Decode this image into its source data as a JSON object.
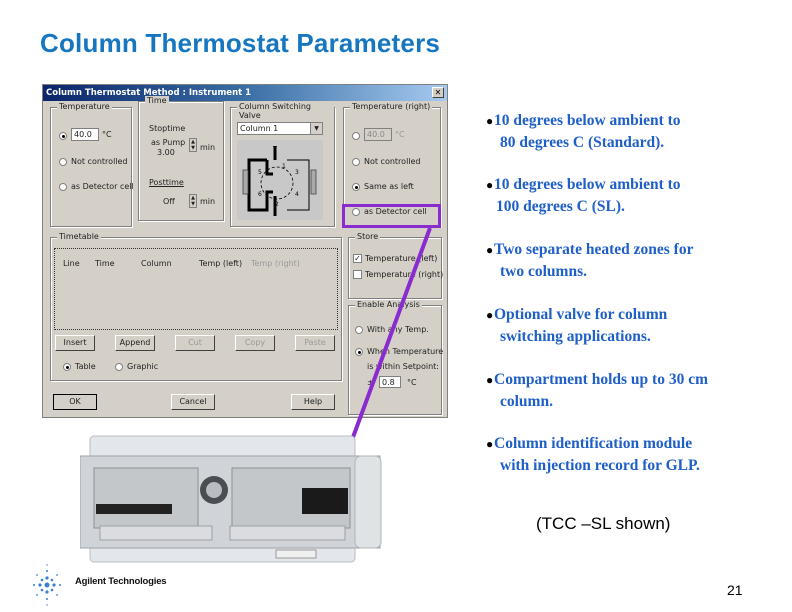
{
  "slide": {
    "title": "Column Thermostat Parameters",
    "page_number": "21",
    "caption": "(TCC –SL shown)",
    "logo_text": "Agilent Technologies",
    "accent_color": "#1677c0",
    "bullet_color": "#1f5fc8",
    "highlight_color": "#8a2bd0"
  },
  "dialog": {
    "title": "Column Thermostat Method : Instrument 1",
    "close_icon": "close-icon",
    "temperature": {
      "label": "Temperature",
      "value": "40.0",
      "unit": "°C",
      "options": [
        "Not controlled",
        "as Detector cell"
      ]
    },
    "time": {
      "label": "Time",
      "stoptime_label": "Stoptime",
      "stoptime_mode": "as Pump",
      "stoptime_value": "3.00",
      "stoptime_unit": "min",
      "posttime_label": "Posttime",
      "posttime_value": "Off",
      "posttime_unit": "min"
    },
    "valve": {
      "label": "Column Switching Valve",
      "selected": "Column 1",
      "ports": [
        "5",
        "6",
        "1",
        "2",
        "3",
        "4"
      ]
    },
    "temperature_right": {
      "label": "Temperature (right)",
      "value": "40.0",
      "unit": "°C",
      "options": [
        "Not controlled",
        "Same as left",
        "as Detector cell"
      ],
      "selected": "Same as left"
    },
    "timetable": {
      "label": "Timetable",
      "columns": [
        "Line",
        "Time",
        "Column",
        "Temp (left)",
        "Temp (right)"
      ],
      "rows": []
    },
    "buttons": {
      "insert": "Insert",
      "append": "Append",
      "cut": "Cut",
      "copy": "Copy",
      "paste": "Paste",
      "ok": "OK",
      "cancel": "Cancel",
      "help": "Help"
    },
    "view": {
      "table": "Table",
      "graphic": "Graphic",
      "selected": "Table"
    },
    "store": {
      "label": "Store",
      "temp_left": "Temperature (left)",
      "temp_left_checked": true,
      "temp_right": "Temperature (right)",
      "temp_right_checked": false
    },
    "enable_analysis": {
      "label": "Enable Analysis",
      "any_temp": "With any Temp.",
      "when_temp": "When Temperature",
      "within": "is within Setpoint:",
      "pm": "±",
      "tolerance": "0.8",
      "unit": "°C",
      "selected": "When Temperature"
    }
  },
  "bullets": [
    {
      "line1": "10 degrees below ambient to",
      "line2": "80 degrees C (Standard)."
    },
    {
      "line1": "10 degrees below ambient to",
      "line2": "100 degrees C (SL)."
    },
    {
      "line1": "Two separate heated zones for",
      "line2": "two columns."
    },
    {
      "line1": "Optional valve for  column",
      "line2": "switching applications."
    },
    {
      "line1": "Compartment holds up to 30  cm",
      "line2": "column."
    },
    {
      "line1": "Column identification module",
      "line2": "with injection record for  GLP."
    }
  ]
}
